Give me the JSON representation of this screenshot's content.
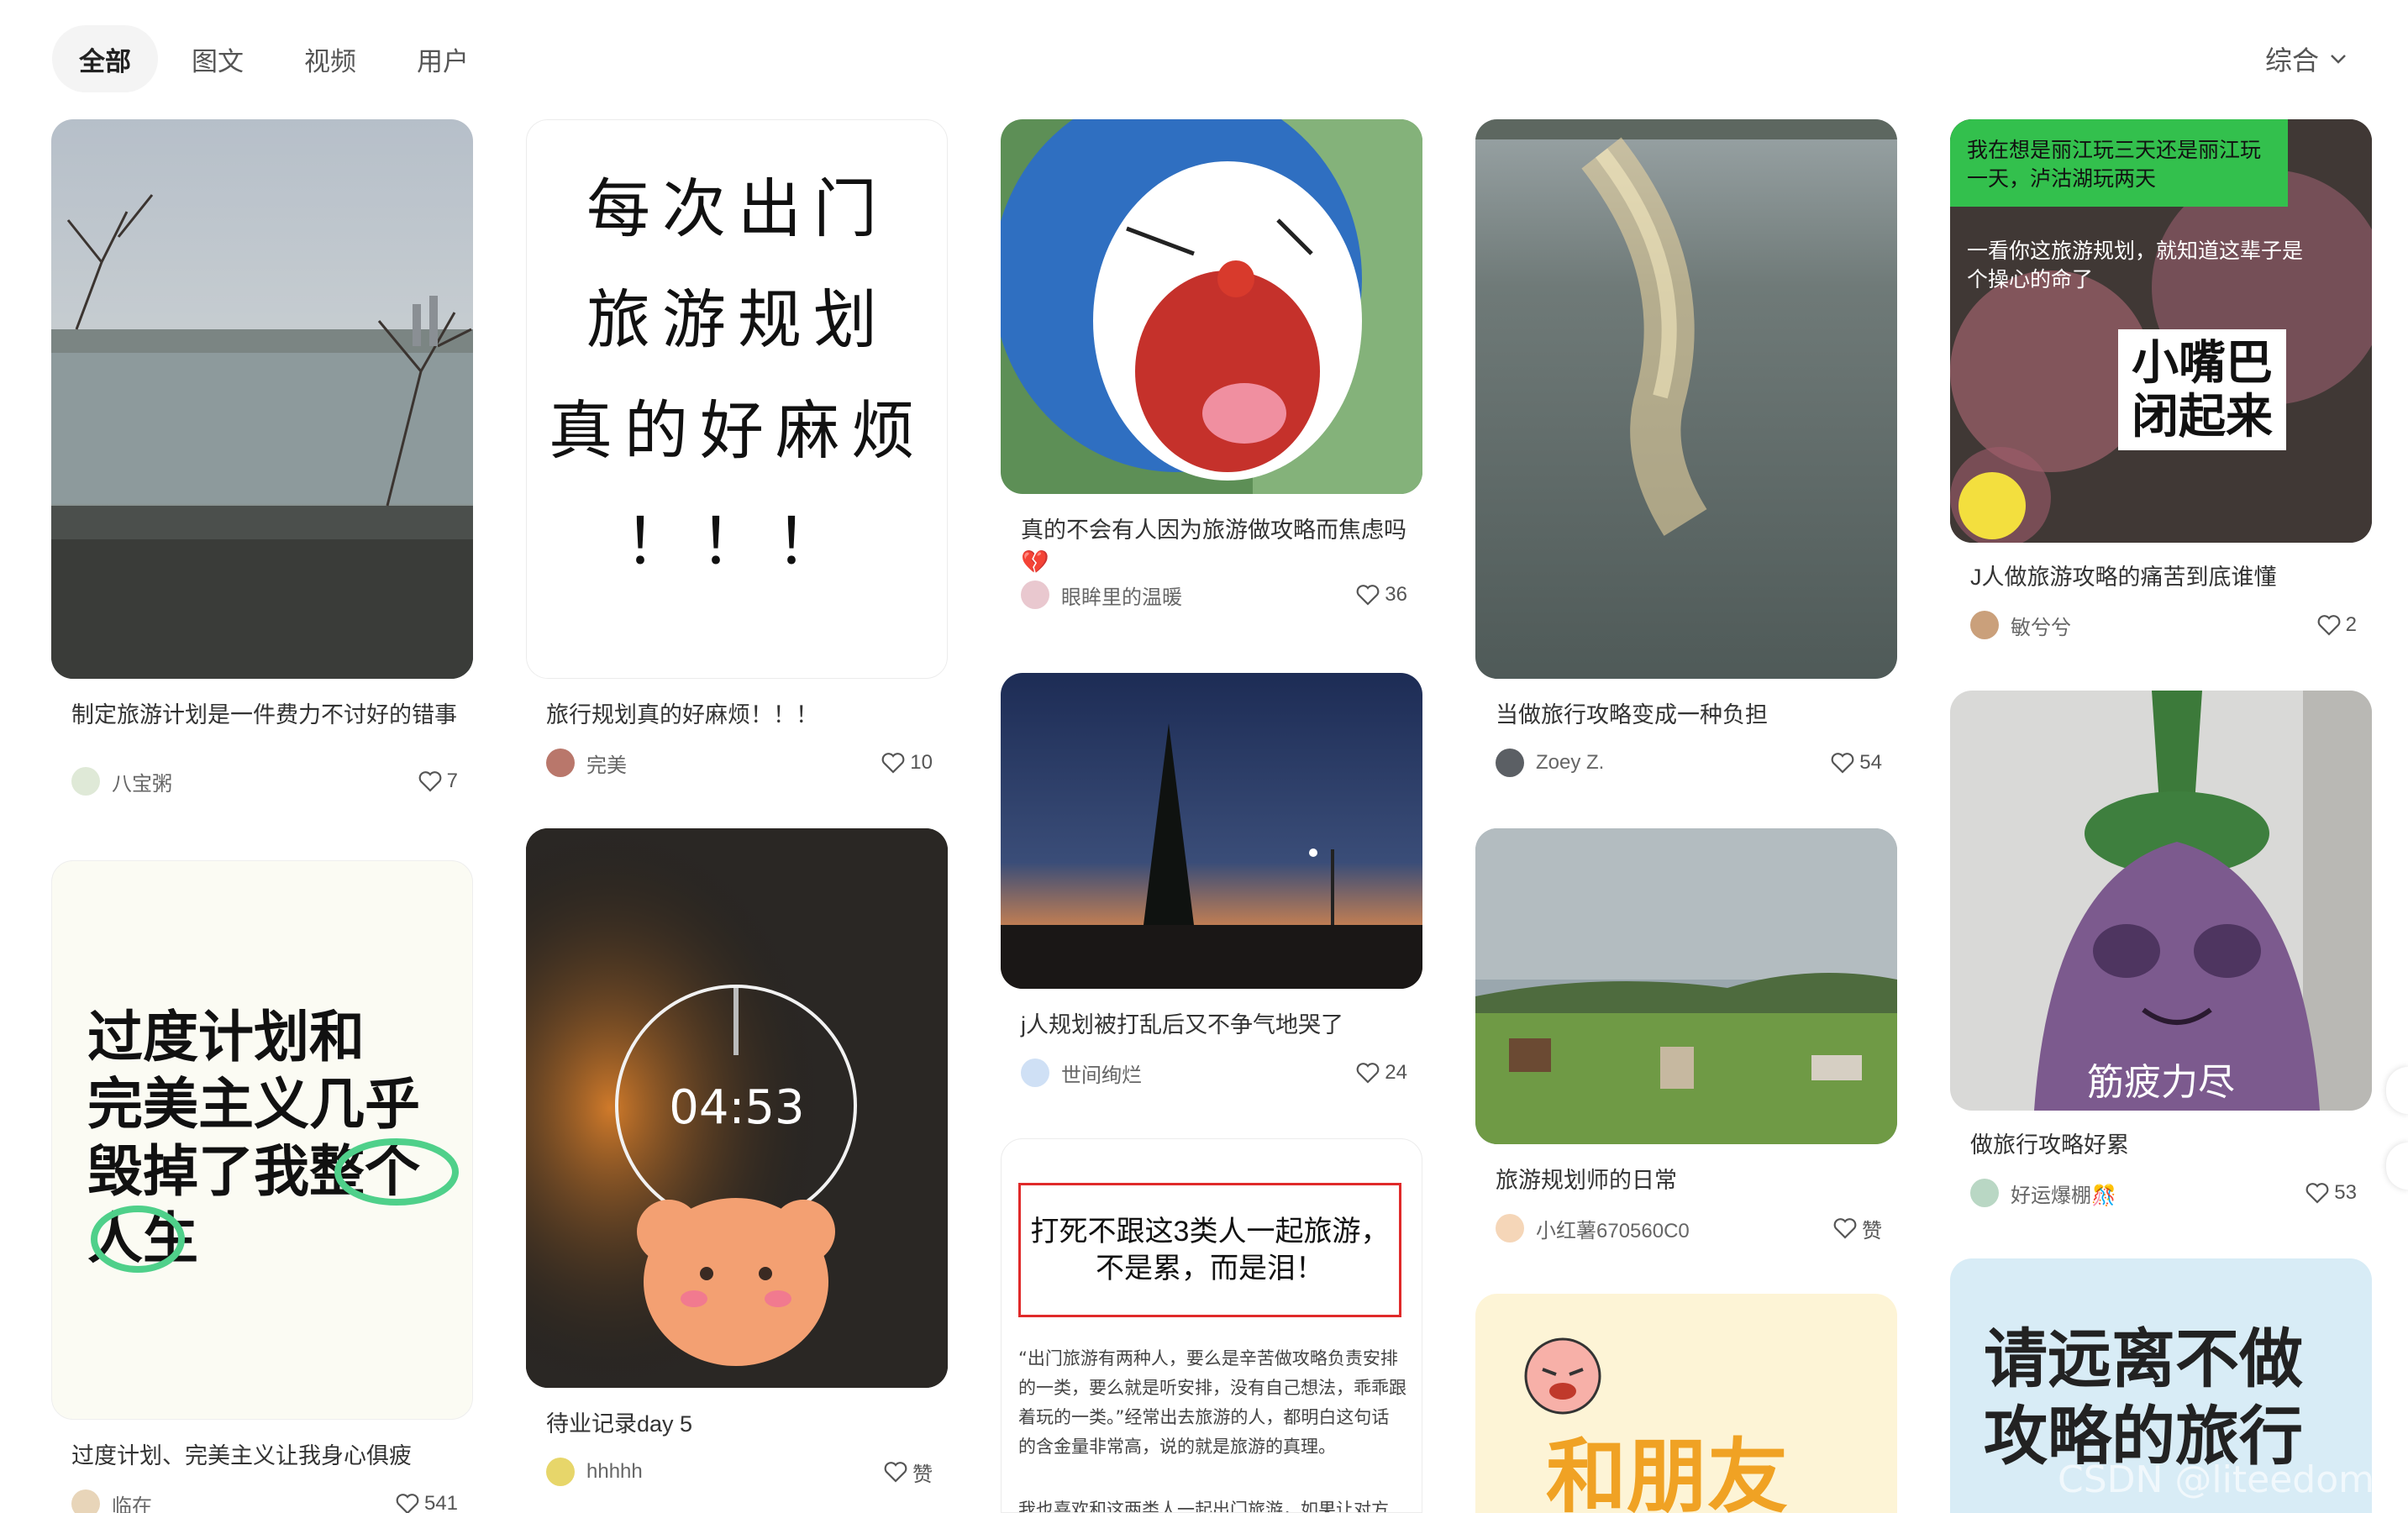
{
  "tabs": [
    "全部",
    "图文",
    "视频",
    "用户"
  ],
  "sort_label": "综合",
  "cards": [
    {
      "title": "制定旅游计划是一件费力不讨好的错事",
      "author": "八宝粥",
      "likes": "7"
    },
    {
      "title": "旅行规划真的好麻烦！！！",
      "author": "完美",
      "likes": "10",
      "image_text": [
        "每次出门",
        "旅游规划",
        "真的好麻烦",
        "！！！"
      ]
    },
    {
      "title": "真的不会有人因为旅游做攻略而焦虑吗💔",
      "author": "眼眸里的温暖",
      "likes": "36"
    },
    {
      "title": "当做旅行攻略变成一种负担",
      "author": "Zoey Z.",
      "likes": "54"
    },
    {
      "title": "J人做旅游攻略的痛苦到底谁懂",
      "author": "敏兮兮",
      "likes": "2",
      "image_text": [
        "我在想是丽江玩三天还是丽江玩一天，泸沽湖玩两天",
        "一看你这旅游规划，就知道这辈子是个操心的命了",
        "小嘴巴",
        "闭起来"
      ]
    },
    {
      "title": "过度计划、完美主义让我身心俱疲",
      "author": "临在",
      "likes": "541",
      "image_text": [
        "过度计划和",
        "完美主义几乎",
        "毁掉了我整个",
        "人生"
      ]
    },
    {
      "title": "待业记录day 5",
      "author": "hhhhh",
      "likes": "赞",
      "image_text": [
        "04:53"
      ]
    },
    {
      "title": "j人规划被打乱后又不争气地哭了",
      "author": "世间绚烂",
      "likes": "24"
    },
    {
      "title": "旅游规划师的日常",
      "author": "小红薯670560C0",
      "likes": "赞"
    },
    {
      "title": "做旅行攻略好累",
      "author": "好运爆棚🎊",
      "likes": "53",
      "image_text": [
        "筋疲力尽"
      ]
    },
    {
      "title": "",
      "author": "",
      "likes": "",
      "image_text": [
        "打死不跟这3类人一起旅游，",
        "不是累，而是泪！",
        "“出门旅游有两种人，要么是辛苦做攻略负责安排的一类，要么就是听安排，没有自己想法，乖乖跟着玩的一类。”经常出去旅游的人，都明白这句话的含金量非常高，说的就是旅游的真理。",
        "我也喜欢和这两类人一起出门旅游，如果让对方"
      ]
    },
    {
      "title": "",
      "author": "",
      "likes": "",
      "image_text": [
        "和朋友"
      ]
    },
    {
      "title": "",
      "author": "",
      "likes": "",
      "image_text": [
        "请远离不做",
        "攻略的旅行"
      ]
    }
  ],
  "watermark": "CSDN @liteedom",
  "colors": {
    "accent": "#ff2442",
    "chat_green": "#33c04d",
    "highlight_green": "#4fd08a"
  }
}
